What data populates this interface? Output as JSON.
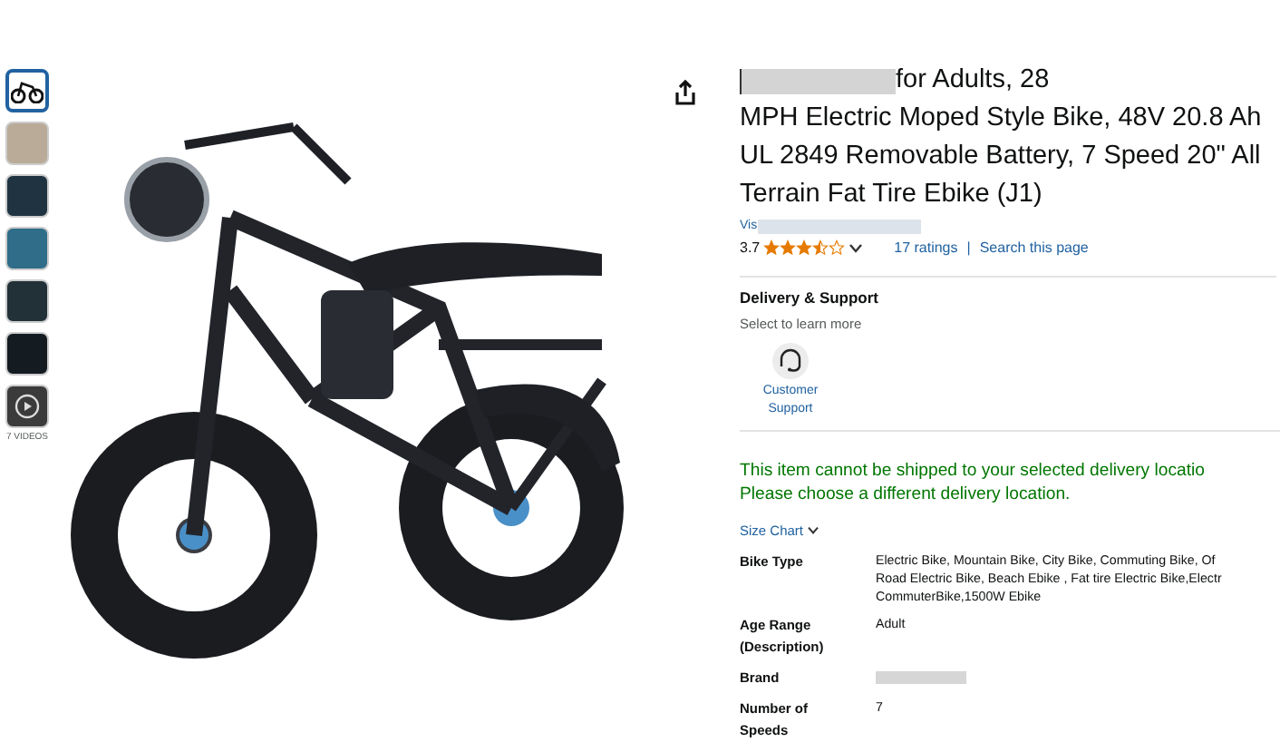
{
  "thumbnails": [
    {
      "selected": true
    },
    {
      "selected": false
    },
    {
      "selected": false
    },
    {
      "selected": false
    },
    {
      "selected": false
    },
    {
      "selected": false
    },
    {
      "selected": false,
      "kind": "video"
    }
  ],
  "videos_label": "7 VIDEOS",
  "product": {
    "title_lines": [
      "for Adults, 28",
      "MPH Electric Moped Style Bike, 48V 20.8 Ah",
      "UL 2849 Removable Battery, 7 Speed 20\" All",
      "Terrain Fat Tire Ebike (J1)"
    ],
    "store_prefix": "Vis",
    "rating": "3.7",
    "stars": 3.5,
    "ratings_link": "17 ratings",
    "separator": "|",
    "search_link": "Search this page"
  },
  "delivery": {
    "heading": "Delivery & Support",
    "subtitle": "Select to learn more",
    "support_lines": [
      "Customer",
      "Support"
    ]
  },
  "shipping_notice": [
    "This item cannot be shipped to your selected delivery locatio",
    "Please choose a different delivery location."
  ],
  "size_chart": "Size Chart",
  "specs": [
    {
      "label": [
        "Bike Type"
      ],
      "value": [
        "Electric Bike, Mountain Bike, City Bike, Commuting Bike, Of",
        "Road Electric Bike, Beach Ebike , Fat tire Electric Bike,Electr",
        "CommuterBike,1500W Ebike"
      ],
      "kind": "text"
    },
    {
      "label": [
        "Age Range",
        "(Description)"
      ],
      "value": [
        "Adult"
      ],
      "kind": "text"
    },
    {
      "label": [
        "Brand"
      ],
      "kind": "blurred"
    },
    {
      "label": [
        "Number of",
        "Speeds"
      ],
      "value": [
        "7"
      ],
      "kind": "text"
    }
  ]
}
